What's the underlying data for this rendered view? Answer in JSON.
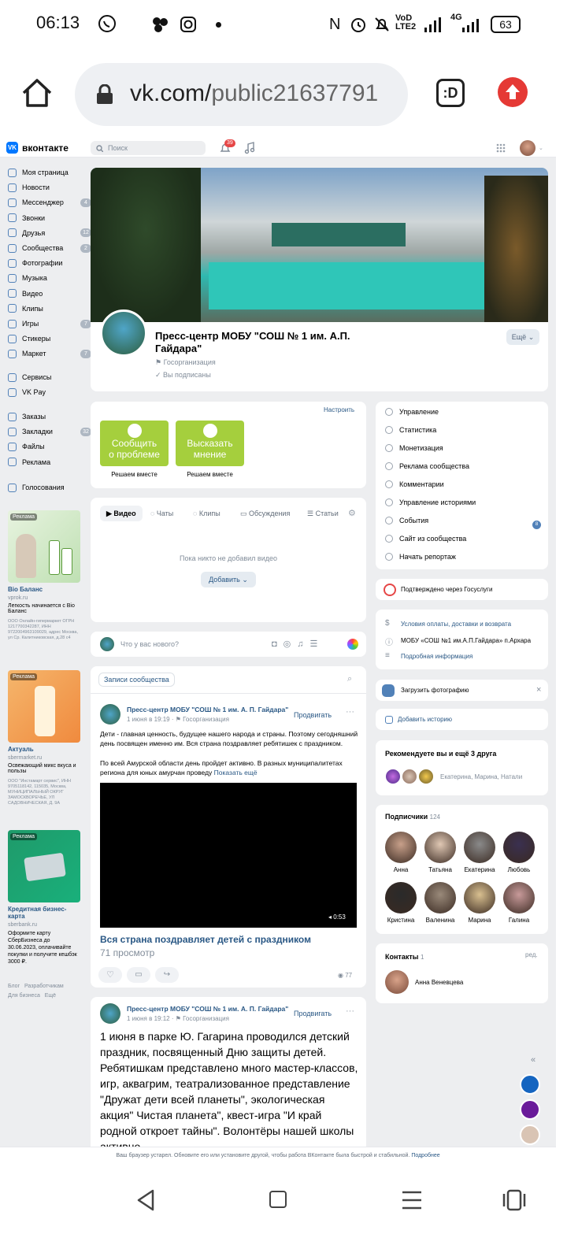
{
  "status": {
    "time": "06:13",
    "battery": "63",
    "network": "4G"
  },
  "browser": {
    "url_host": "vk.com/",
    "url_path": "public21637791",
    "tab_icon": ":D"
  },
  "vk": {
    "logo": "вконтакте",
    "search_placeholder": "Поиск",
    "notif_count": "39",
    "nav": [
      {
        "label": "Моя страница",
        "count": ""
      },
      {
        "label": "Новости",
        "count": ""
      },
      {
        "label": "Мессенджер",
        "count": "4"
      },
      {
        "label": "Звонки",
        "count": ""
      },
      {
        "label": "Друзья",
        "count": "12"
      },
      {
        "label": "Сообщества",
        "count": "2"
      },
      {
        "label": "Фотографии",
        "count": ""
      },
      {
        "label": "Музыка",
        "count": ""
      },
      {
        "label": "Видео",
        "count": ""
      },
      {
        "label": "Клипы",
        "count": ""
      },
      {
        "label": "Игры",
        "count": "7"
      },
      {
        "label": "Стикеры",
        "count": ""
      },
      {
        "label": "Маркет",
        "count": "7"
      }
    ],
    "nav2": [
      {
        "label": "Сервисы"
      },
      {
        "label": "VK Pay"
      }
    ],
    "nav3": [
      {
        "label": "Заказы",
        "count": ""
      },
      {
        "label": "Закладки",
        "count": "32"
      },
      {
        "label": "Файлы",
        "count": ""
      },
      {
        "label": "Реклама",
        "count": ""
      }
    ],
    "nav4": [
      {
        "label": "Голосования"
      }
    ],
    "ads": [
      {
        "badge": "Реклама",
        "title": "Bio Баланс",
        "domain": "vprok.ru",
        "text": "Легкость начинается с Bio Баланс",
        "legal": "ООО Онлайн-гипермаркет ОГРН 1217700342287, ИНН 9722004963109029, адрес Москва, ул Ср. Калитниковская, д.28 с4"
      },
      {
        "badge": "Реклама",
        "title": "Актуаль",
        "domain": "sbermarket.ru",
        "text": "Освежающий микс вкуса и пользы",
        "legal": "ООО \"Инстамарт сервис\", ИНН 9705118142, 115035, Москва, МУНИЦИПАЛЬНЫЙ ОКРУГ ЗАМОСКВОРЕЧЬЕ, УЛ САДОВНИЧЕСКАЯ, Д. 9А"
      },
      {
        "badge": "Реклама",
        "title": "Кредитная бизнес-карта",
        "domain": "sberbank.ru",
        "text": "Оформите карту СберБизнеса до 30.06.2023, оплачивайте покупки и получите кешбэк 3000 ₽."
      }
    ],
    "footer_links": [
      "Блог",
      "Разработчикам",
      "Для бизнеса",
      "Ещё"
    ],
    "community": {
      "name_line1": "Пресс-центр МОБУ \"СОШ № 1 им. А.П.",
      "name_line2": "Гайдара\"",
      "type": "Госорганизация",
      "subscribed": "Вы подписаны",
      "more_btn": "Ещё"
    },
    "widgets": {
      "setup": "Настроить",
      "btn1_line1": "Сообщить",
      "btn1_line2": "о проблеме",
      "btn1_caption": "Решаем вместе",
      "btn2_line1": "Высказать",
      "btn2_line2": "мнение",
      "btn2_caption": "Решаем вместе"
    },
    "tabs": [
      "Видео",
      "Чаты",
      "Клипы",
      "Обсуждения",
      "Статьи"
    ],
    "empty_video": "Пока никто не добавил видео",
    "add_btn": "Добавить",
    "composer_placeholder": "Что у вас нового?",
    "wall_tab": "Записи сообщества",
    "post1": {
      "author": "Пресс-центр МОБУ \"СОШ № 1 им. А. П. Гайдара\"",
      "date": "1 июня в 19:19",
      "type": "Госорганизация",
      "promote": "Продвигать",
      "text1": "Дети - главная ценность, будущее нашего народа и страны. Поэтому сегодняшний день посвящен именно им. Вся страна поздравляет ребятишек с праздником.",
      "text2": "По всей Амурской области день пройдет активно. В разных муниципалитетах региона для юных амурчан проведу",
      "show_more": "Показать ещё",
      "duration": "0:53",
      "video_title": "Вся страна поздравляет детей с праздником",
      "views_text": "71 просмотр",
      "views": "77"
    },
    "post2": {
      "author": "Пресс-центр МОБУ \"СОШ № 1 им. А. П. Гайдара\"",
      "date": "1 июня в 19:12",
      "type": "Госорганизация",
      "promote": "Продвигать",
      "text": "1 июня в парке Ю. Гагарина проводился детский праздник, посвященный Дню защиты детей. Ребятишкам представлено много мастер-классов, игр, аквагрим, театрализованное представление \"Дружат дети всей планеты\", экологическая акция\" Чистая планета\", квест-игра \"И край родной откроет тайны\". Волонтёры нашей школы активно"
    },
    "admin_menu": [
      "Управление",
      "Статистика",
      "Монетизация",
      "Реклама сообщества",
      "Комментарии",
      "Управление историями",
      "События",
      "Сайт из сообщества",
      "Начать репортаж"
    ],
    "events_badge": "8",
    "gosuslugi": "Подтверждено через Госуслуги",
    "info": {
      "link1": "Условия оплаты, доставки и возврата",
      "address": "МОБУ «СОШ №1 им.А.П.Гайдара» п.Архара",
      "link2": "Подробная информация"
    },
    "upload_photo": "Загрузить фотографию",
    "add_story": "Добавить историю",
    "recommend": {
      "title": "Рекомендуете вы и ещё 3 друга",
      "names": "Екатерина, Марина, Натали"
    },
    "subscribers": {
      "title": "Подписчики",
      "count": "124",
      "people": [
        "Анна",
        "Татьяна",
        "Екатерина",
        "Любовь",
        "Кристина",
        "Валенина",
        "Марина",
        "Галина"
      ]
    },
    "contacts": {
      "title": "Контакты",
      "count": "1",
      "edit": "ред.",
      "name": "Анна Веневцева"
    },
    "outdated": "Ваш браузер устарел. Обновите его или установите другой, чтобы работа ВКонтакте была быстрой и стабильной.",
    "outdated_link": "Подробнее"
  }
}
